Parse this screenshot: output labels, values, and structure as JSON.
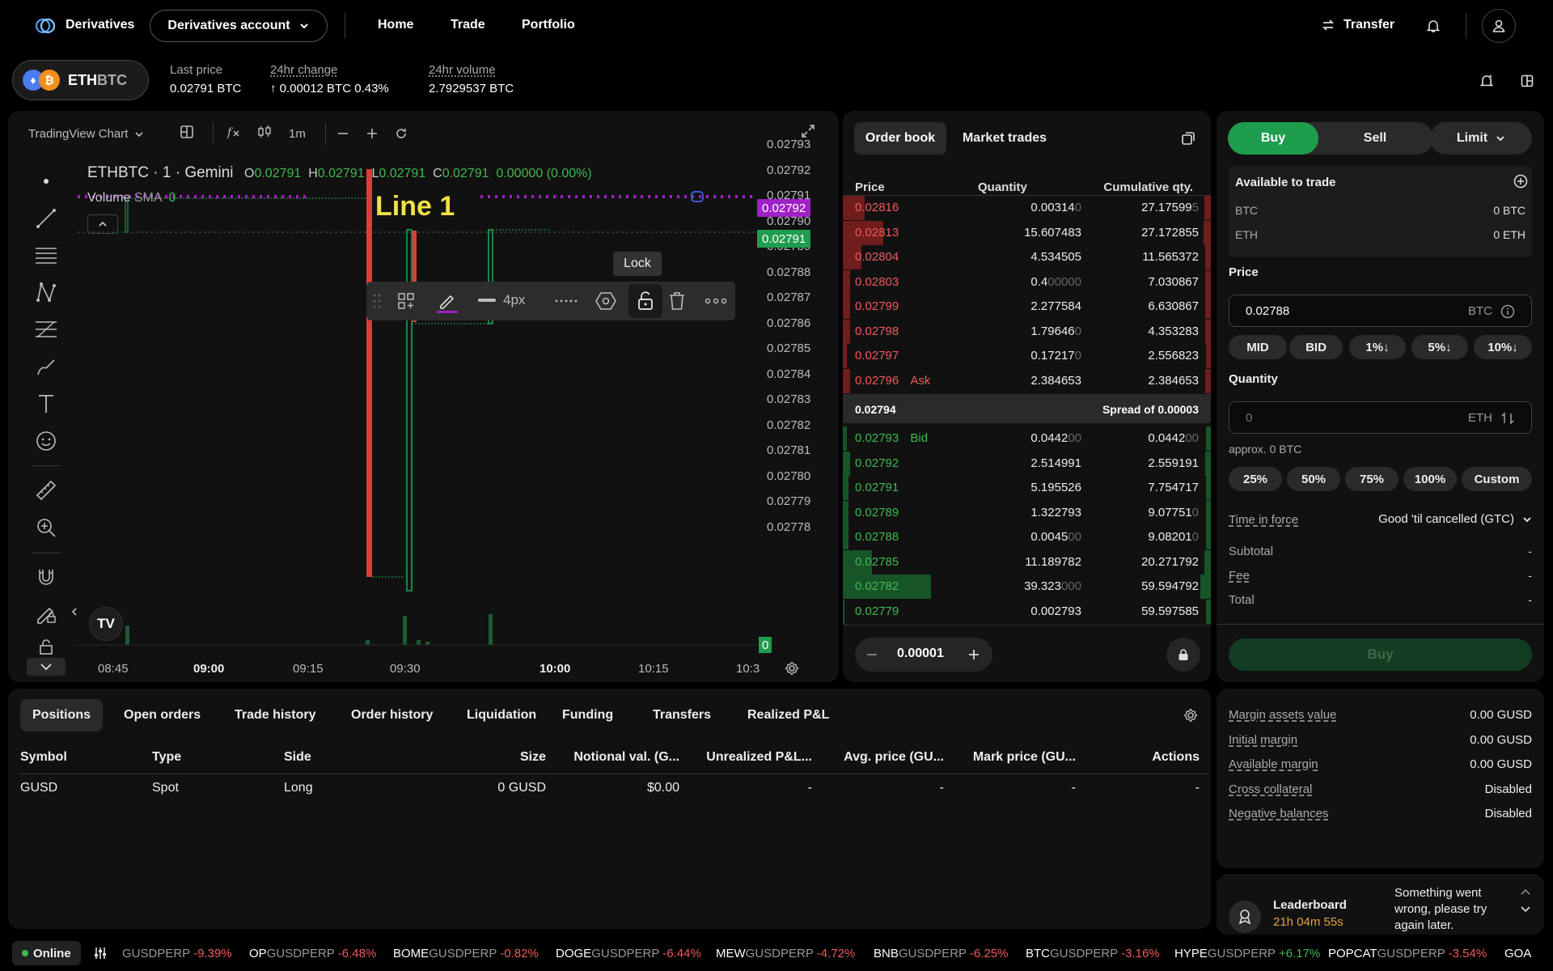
{
  "nav": {
    "brand": "Derivatives",
    "account_label": "Derivatives account",
    "links": [
      "Home",
      "Trade",
      "Portfolio"
    ],
    "transfer_label": "Transfer"
  },
  "ticker": {
    "pair_base": "ETH",
    "pair_quote": "BTC",
    "last_price_label": "Last price",
    "last_price": "0.02791 BTC",
    "change_label": "24hr change",
    "change_value": "↑ 0.00012 BTC 0.43%",
    "volume_label": "24hr volume",
    "volume_value": "2.7929537 BTC"
  },
  "chart": {
    "source_label": "TradingView Chart",
    "interval": "1m",
    "title": "ETHBTC · 1 · Gemini",
    "ohlc": {
      "o": "0.02791",
      "h": "0.02791",
      "l": "0.02791",
      "c": "0.02791",
      "chg": "0.00000 (0.00%)"
    },
    "volume_label": "Volume",
    "sma_label": "SMA",
    "sma_value": "0",
    "line_label": "Line 1",
    "line_width_label": "4px",
    "tooltip": "Lock",
    "price_ticks": [
      "0.02793",
      "0.02792",
      "0.02791",
      "0.02790",
      "0.02789",
      "0.02788",
      "0.02787",
      "0.02786",
      "0.02785",
      "0.02784",
      "0.02783",
      "0.02782",
      "0.02781",
      "0.02780",
      "0.02779",
      "0.02778"
    ],
    "line_price_tag": "0.02792",
    "last_price_tag": "0.02791",
    "volume_tag": "0",
    "time_ticks": [
      "08:45",
      "09:00",
      "09:15",
      "09:30",
      "10:00",
      "10:15",
      "10:3"
    ],
    "bold_time_ticks": [
      "09:00",
      "10:00"
    ],
    "colors": {
      "up": "#22ab5c",
      "down": "#e03b3b",
      "line": "#a020c8"
    }
  },
  "orderbook": {
    "tabs": [
      "Order book",
      "Market trades"
    ],
    "headers": [
      "Price",
      "Quantity",
      "Cumulative qty."
    ],
    "asks": [
      {
        "price": "0.02816",
        "qty": "0.00314",
        "qty_dim": "0",
        "cum": "27.17599",
        "cum_dim": "5",
        "depth": 0.06
      },
      {
        "price": "0.02813",
        "qty": "15.607483",
        "qty_dim": "",
        "cum": "27.172855",
        "cum_dim": "",
        "depth": 0.11
      },
      {
        "price": "0.02804",
        "qty": "4.534505",
        "qty_dim": "",
        "cum": "11.565372",
        "cum_dim": "",
        "depth": 0.05
      },
      {
        "price": "0.02803",
        "qty": "0.4",
        "qty_dim": "00000",
        "cum": "7.030867",
        "cum_dim": "",
        "depth": 0.02
      },
      {
        "price": "0.02799",
        "qty": "2.277584",
        "qty_dim": "",
        "cum": "6.630867",
        "cum_dim": "",
        "depth": 0.02
      },
      {
        "price": "0.02798",
        "qty": "1.79646",
        "qty_dim": "0",
        "cum": "4.353283",
        "cum_dim": "",
        "depth": 0.02
      },
      {
        "price": "0.02797",
        "qty": "0.17217",
        "qty_dim": "0",
        "cum": "2.556823",
        "cum_dim": "",
        "depth": 0.01
      },
      {
        "price": "0.02796",
        "qty": "2.384653",
        "qty_dim": "",
        "cum": "2.384653",
        "cum_dim": "",
        "depth": 0.02,
        "tag": "Ask"
      }
    ],
    "mid_price": "0.02794",
    "spread_label": "Spread of 0.00003",
    "bids": [
      {
        "price": "0.02793",
        "qty": "0.0442",
        "qty_dim": "00",
        "cum": "0.0442",
        "cum_dim": "00",
        "depth": 0.01,
        "tag": "Bid"
      },
      {
        "price": "0.02792",
        "qty": "2.514991",
        "qty_dim": "",
        "cum": "2.559191",
        "cum_dim": "",
        "depth": 0.02
      },
      {
        "price": "0.02791",
        "qty": "5.195526",
        "qty_dim": "",
        "cum": "7.754717",
        "cum_dim": "",
        "depth": 0.015
      },
      {
        "price": "0.02789",
        "qty": "1.322793",
        "qty_dim": "",
        "cum": "9.07751",
        "cum_dim": "0",
        "depth": 0.015
      },
      {
        "price": "0.02788",
        "qty": "0.0045",
        "qty_dim": "00",
        "cum": "9.08201",
        "cum_dim": "0",
        "depth": 0.015
      },
      {
        "price": "0.02785",
        "qty": "11.189782",
        "qty_dim": "",
        "cum": "20.271792",
        "cum_dim": "",
        "depth": 0.08
      },
      {
        "price": "0.02782",
        "qty": "39.323",
        "qty_dim": "000",
        "cum": "59.594792",
        "cum_dim": "",
        "depth": 0.24
      },
      {
        "price": "0.02779",
        "qty": "0.002793",
        "qty_dim": "",
        "cum": "59.597585",
        "cum_dim": "",
        "depth": 0.005
      }
    ],
    "tick_size": "0.00001"
  },
  "trade": {
    "buy_label": "Buy",
    "sell_label": "Sell",
    "order_type": "Limit",
    "available_label": "Available to trade",
    "balances": [
      {
        "asset": "BTC",
        "value": "0 BTC"
      },
      {
        "asset": "ETH",
        "value": "0 ETH"
      }
    ],
    "price_label": "Price",
    "price_value": "0.02788",
    "price_unit": "BTC",
    "price_chips": [
      "MID",
      "BID",
      "1%↓",
      "5%↓",
      "10%↓"
    ],
    "quantity_label": "Quantity",
    "quantity_placeholder": "0",
    "quantity_unit": "ETH",
    "approx": "approx. 0 BTC",
    "qty_chips": [
      "25%",
      "50%",
      "75%",
      "100%",
      "Custom"
    ],
    "tif_label": "Time in force",
    "tif_value": "Good 'til cancelled (GTC)",
    "subtotal_label": "Subtotal",
    "subtotal_value": "-",
    "fee_label": "Fee",
    "fee_value": "-",
    "total_label": "Total",
    "total_value": "-",
    "submit_label": "Buy"
  },
  "positions": {
    "tabs": [
      "Positions",
      "Open orders",
      "Trade history",
      "Order history",
      "Liquidation",
      "Funding",
      "Transfers",
      "Realized P&L"
    ],
    "headers": [
      "Symbol",
      "Type",
      "Side",
      "Size",
      "Notional val. (G...",
      "Unrealized P&L...",
      "Avg. price (GU...",
      "Mark price (GU...",
      "Actions"
    ],
    "rows": [
      [
        "GUSD",
        "Spot",
        "Long",
        "0 GUSD",
        "$0.00",
        "-",
        "-",
        "-",
        "-"
      ]
    ]
  },
  "margin": {
    "items": [
      {
        "label": "Margin assets value",
        "value": "0.00 GUSD"
      },
      {
        "label": "Initial margin",
        "value": "0.00 GUSD"
      },
      {
        "label": "Available margin",
        "value": "0.00 GUSD"
      },
      {
        "label": "Cross collateral",
        "value": "Disabled"
      },
      {
        "label": "Negative balances",
        "value": "Disabled"
      }
    ]
  },
  "leaderboard": {
    "title": "Leaderboard",
    "countdown": "21h 04m 55s",
    "message": "Something went wrong, please try again later."
  },
  "footer": {
    "status": "Online",
    "tickers": [
      {
        "sym": "",
        "pre": "GUSDPERP",
        "chg": "-9.39%",
        "up": false
      },
      {
        "sym": "OP",
        "pre": "GUSDPERP",
        "chg": "-6.48%",
        "up": false
      },
      {
        "sym": "BOME",
        "pre": "GUSDPERP",
        "chg": "-0.82%",
        "up": false
      },
      {
        "sym": "DOGE",
        "pre": "GUSDPERP",
        "chg": "-6.44%",
        "up": false
      },
      {
        "sym": "MEW",
        "pre": "GUSDPERP",
        "chg": "-4.72%",
        "up": false
      },
      {
        "sym": "BNB",
        "pre": "GUSDPERP",
        "chg": "-6.25%",
        "up": false
      },
      {
        "sym": "BTC",
        "pre": "GUSDPERP",
        "chg": "-3.16%",
        "up": false
      },
      {
        "sym": "HYPE",
        "pre": "GUSDPERP",
        "chg": "+6.17%",
        "up": true
      },
      {
        "sym": "POPCAT",
        "pre": "GUSDPERP",
        "chg": "-3.54%",
        "up": false
      },
      {
        "sym": "GOA",
        "pre": "",
        "chg": "",
        "up": false
      }
    ]
  }
}
